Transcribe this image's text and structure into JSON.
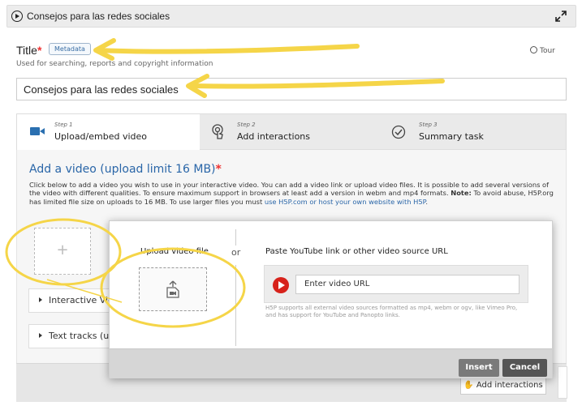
{
  "header": {
    "title": "Consejos para las redes sociales"
  },
  "title_field": {
    "label": "Title",
    "required_mark": "*",
    "metadata_tag": "Metadata",
    "description": "Used for searching, reports and copyright information",
    "value": "Consejos para las redes sociales",
    "tour_label": "Tour"
  },
  "tabs": [
    {
      "step": "Step 1",
      "label": "Upload/embed video",
      "icon": "video-camera-icon"
    },
    {
      "step": "Step 2",
      "label": "Add interactions",
      "icon": "touch-icon"
    },
    {
      "step": "Step 3",
      "label": "Summary task",
      "icon": "check-circle-icon"
    }
  ],
  "main": {
    "heading": "Add a video (upload limit 16 MB)",
    "required_mark": "*",
    "description": "Click below to add a video you wish to use in your interactive video. You can add a video link or upload video files. It is possible to add several versions of the video with different qualities. To ensure maximum support in browsers at least add a version in webm and mp4 formats.",
    "note_label": "Note:",
    "note_text": " To avoid abuse, H5P.org has limited file size on uploads to 16 MB. To use larger files you must ",
    "note_link": "use H5P.com or host your own website with H5P",
    "note_end": ".",
    "add_plus": "+",
    "accordions": [
      {
        "label": "Interactive Video"
      },
      {
        "label": "Text tracks (unsupported for YouTube videos)"
      }
    ],
    "add_interactions_button": "Add interactions"
  },
  "dialog": {
    "upload_label": "Upload video file",
    "or_label": "or",
    "paste_label": "Paste YouTube link or other video source URL",
    "url_placeholder": "Enter video URL",
    "help_text": "H5P supports all external video sources formatted as mp4, webm or ogv, like Vimeo Pro, and has support for YouTube and Panopto links.",
    "insert_button": "Insert",
    "cancel_button": "Cancel"
  },
  "colors": {
    "accent": "#2a66a8",
    "annotation": "#f5d548",
    "youtube_red": "#d7221b",
    "required": "#e33333"
  }
}
